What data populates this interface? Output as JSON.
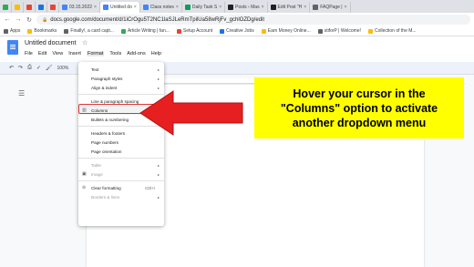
{
  "browser": {
    "tabs": [
      {
        "label": "",
        "color": "#34a853"
      },
      {
        "label": "",
        "color": "#fbbc04"
      },
      {
        "label": "",
        "color": "#ea4335"
      },
      {
        "label": "",
        "color": "#1a73e8"
      },
      {
        "label": "",
        "color": "#ea4335"
      },
      {
        "label": "03.15.2022",
        "color": "#4285f4"
      },
      {
        "label": "Untitled do",
        "color": "#4285f4",
        "active": true
      },
      {
        "label": "Class notes",
        "color": "#4285f4"
      },
      {
        "label": "Daily Task S",
        "color": "#0f9d58"
      },
      {
        "label": "Posts ‹ Mas",
        "color": "#202124"
      },
      {
        "label": "Edit Post \"H",
        "color": "#202124"
      },
      {
        "label": "FAQPage |",
        "color": "#5f6368"
      }
    ],
    "url": "docs.google.com/document/d/1iCrOgu5T2NC1laSJLeRmTpilUa58wRjFv_gchlOZDg/edit",
    "bookmarks": [
      {
        "label": "Apps",
        "color": "#5f6368"
      },
      {
        "label": "Bookmarks",
        "color": "#fbbc04"
      },
      {
        "label": "Finally!, a card capt...",
        "color": "#5f6368"
      },
      {
        "label": "Article Writing | fan...",
        "color": "#34a853"
      },
      {
        "label": "Setup Account",
        "color": "#ea4335"
      },
      {
        "label": "Creative Jobs",
        "color": "#1a73e8"
      },
      {
        "label": "Earn Money Online...",
        "color": "#fbbc04"
      },
      {
        "label": "stiforP | Welcome!",
        "color": "#5f6368"
      },
      {
        "label": "Collection of the M...",
        "color": "#fbbc04"
      }
    ]
  },
  "doc": {
    "title": "Untitled document",
    "menus": [
      "File",
      "Edit",
      "View",
      "Insert",
      "Format",
      "Tools",
      "Add-ons",
      "Help"
    ],
    "zoom": "100%"
  },
  "format_menu": {
    "items": [
      {
        "label": "Text",
        "icon": "",
        "submenu": true
      },
      {
        "label": "Paragraph styles",
        "icon": "",
        "submenu": true
      },
      {
        "label": "Align & indent",
        "icon": "",
        "submenu": true
      },
      {
        "label": "Line & paragraph spacing",
        "icon": "",
        "submenu": true
      },
      {
        "label": "Columns",
        "icon": "▥",
        "submenu": true,
        "highlighted": true
      },
      {
        "label": "Bullets & numbering",
        "icon": "",
        "submenu": true
      },
      {
        "label": "Headers & footers",
        "icon": "",
        "submenu": false
      },
      {
        "label": "Page numbers",
        "icon": "",
        "submenu": false
      },
      {
        "label": "Page orientation",
        "icon": "",
        "submenu": false
      },
      {
        "label": "Table",
        "icon": "",
        "submenu": true,
        "disabled": true
      },
      {
        "label": "Image",
        "icon": "▣",
        "submenu": true,
        "disabled": true
      },
      {
        "label": "Clear formatting",
        "icon": "⊘",
        "shortcut": "Ctrl+\\"
      },
      {
        "label": "Borders & lines",
        "icon": "",
        "submenu": true,
        "disabled": true
      }
    ],
    "highlight_color": "#e33232"
  },
  "annotation": {
    "text": "Hover your cursor in the \"Columns\" option to activate another dropdown menu",
    "bg_color": "#ffff00",
    "arrow_color": "#e62020"
  }
}
